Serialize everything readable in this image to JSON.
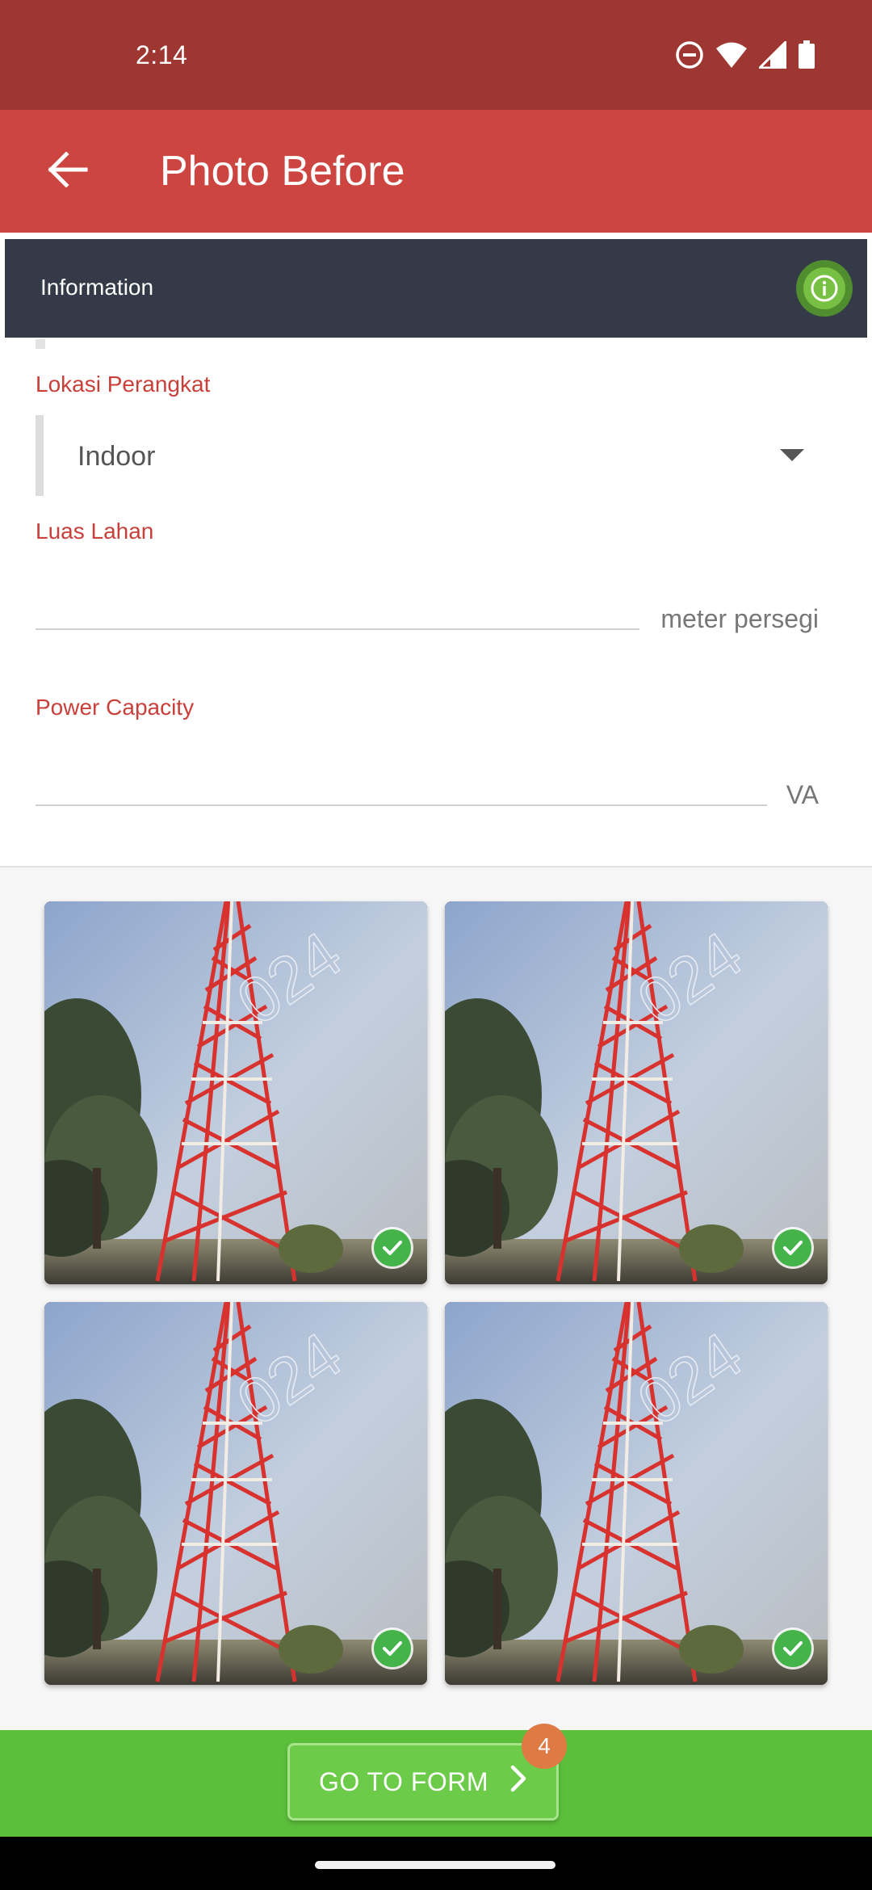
{
  "status_bar": {
    "time": "2:14",
    "icons": [
      "do-not-disturb-icon",
      "wifi-icon",
      "signal-icon",
      "battery-icon"
    ]
  },
  "app_bar": {
    "title": "Photo Before",
    "back_icon": "arrow-back-icon"
  },
  "info_panel": {
    "label": "Information",
    "icon": "info-icon"
  },
  "form": {
    "lokasi": {
      "label": "Lokasi Perangkat",
      "selected": "Indoor"
    },
    "luas": {
      "label": "Luas Lahan",
      "value": "",
      "unit": "meter persegi"
    },
    "power": {
      "label": "Power Capacity",
      "value": "",
      "unit": "VA"
    }
  },
  "photos": [
    {
      "checked": true,
      "watermark": "024"
    },
    {
      "checked": true,
      "watermark": "024"
    },
    {
      "checked": true,
      "watermark": "024"
    },
    {
      "checked": true,
      "watermark": "024"
    }
  ],
  "action_bar": {
    "button_label": "GO TO FORM",
    "badge_count": "4"
  },
  "colors": {
    "status_bar": "#9e3631",
    "app_bar": "#cc4541",
    "info_bar": "#343a47",
    "label_red": "#c9403b",
    "action_green": "#5bbf3b",
    "badge_orange": "#e07a45",
    "check_green": "#43b34a"
  }
}
